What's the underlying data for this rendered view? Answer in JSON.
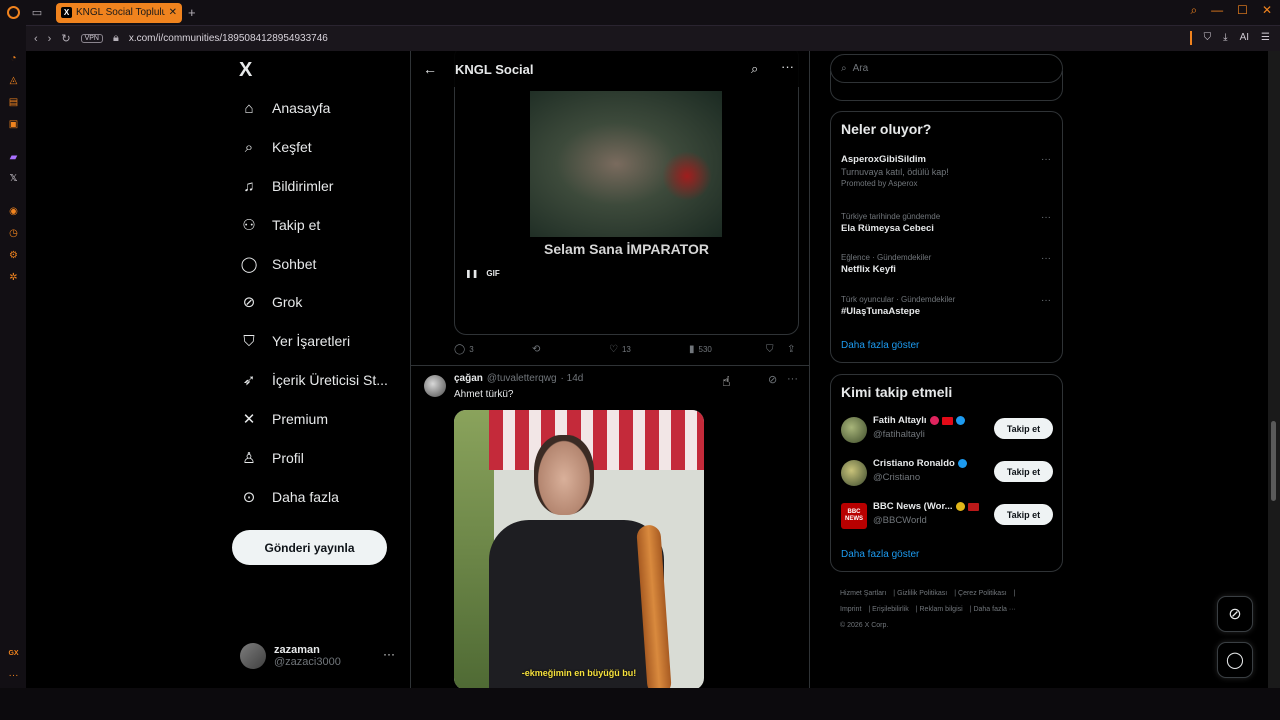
{
  "browser": {
    "tab_title": "KNGL Social Topluluk / X",
    "tab_x_label": "X",
    "url": "x.com/i/communities/1895084128954933746",
    "vpn_label": "VPN",
    "ai_label": "AI",
    "gx_label": "GX",
    "accent": "#f0831e"
  },
  "nav": {
    "logo": "X",
    "items": [
      {
        "label": "Anasayfa",
        "icon": "home-icon"
      },
      {
        "label": "Keşfet",
        "icon": "search-icon"
      },
      {
        "label": "Bildirimler",
        "icon": "bell-icon"
      },
      {
        "label": "Takip et",
        "icon": "follow-icon"
      },
      {
        "label": "Sohbet",
        "icon": "chat-icon"
      },
      {
        "label": "Grok",
        "icon": "grok-icon"
      },
      {
        "label": "Yer İşaretleri",
        "icon": "bookmark-icon"
      },
      {
        "label": "İçerik Üreticisi St...",
        "icon": "rocket-icon"
      },
      {
        "label": "Premium",
        "icon": "x-icon"
      },
      {
        "label": "Profil",
        "icon": "person-icon"
      },
      {
        "label": "Daha fazla",
        "icon": "more-circle-icon"
      }
    ],
    "post_button": "Gönderi yayınla",
    "account": {
      "name": "zazaman",
      "handle": "@zazaci3000"
    }
  },
  "community": {
    "title": "KNGL Social"
  },
  "tweet1": {
    "gif_caption": "Selam Sana İMPARATOR",
    "gif_label": "GIF",
    "replies": "3",
    "likes": "13",
    "views": "530"
  },
  "tweet2": {
    "name": "çağan",
    "handle": "@tuvaletterqwg",
    "time": "· 14d",
    "text": "Ahmet türkü?",
    "video_subtitle": "-ekmeğimin en büyüğü bu!"
  },
  "search": {
    "placeholder": "Ara"
  },
  "trends": {
    "title": "Neler oluyor?",
    "items": [
      {
        "meta": "",
        "name": "AsperoxGibiSildim",
        "sub": "Turnuvaya katıl, ödülü kap!",
        "promo": "Promoted by Asperox"
      },
      {
        "meta": "Türkiye tarihinde gündemde",
        "name": "Ela Rümeysa Cebeci"
      },
      {
        "meta": "Eğlence · Gündemdekiler",
        "name": "Netflix Keyfi"
      },
      {
        "meta": "Türk oyuncular · Gündemdekiler",
        "name": "#UlaşTunaAstepe"
      }
    ],
    "show_more": "Daha fazla göster"
  },
  "who_to_follow": {
    "title": "Kimi takip etmeli",
    "users": [
      {
        "name": "Fatih Altaylı",
        "handle": "@fatihaltayli",
        "button": "Takip et"
      },
      {
        "name": "Cristiano Ronaldo",
        "handle": "@Cristiano",
        "button": "Takip et"
      },
      {
        "name": "BBC News (Wor...",
        "handle": "@BBCWorld",
        "button": "Takip et",
        "avatar_text": "BBC NEWS"
      }
    ],
    "show_more": "Daha fazla göster"
  },
  "footer": {
    "links": [
      "Hizmet Şartları",
      "Gizlilik Politikası",
      "Çerez Politikası",
      "Imprint",
      "Erişilebilirlik",
      "Reklam bilgisi",
      "Daha fazla ···"
    ],
    "copyright": "© 2026 X Corp."
  }
}
